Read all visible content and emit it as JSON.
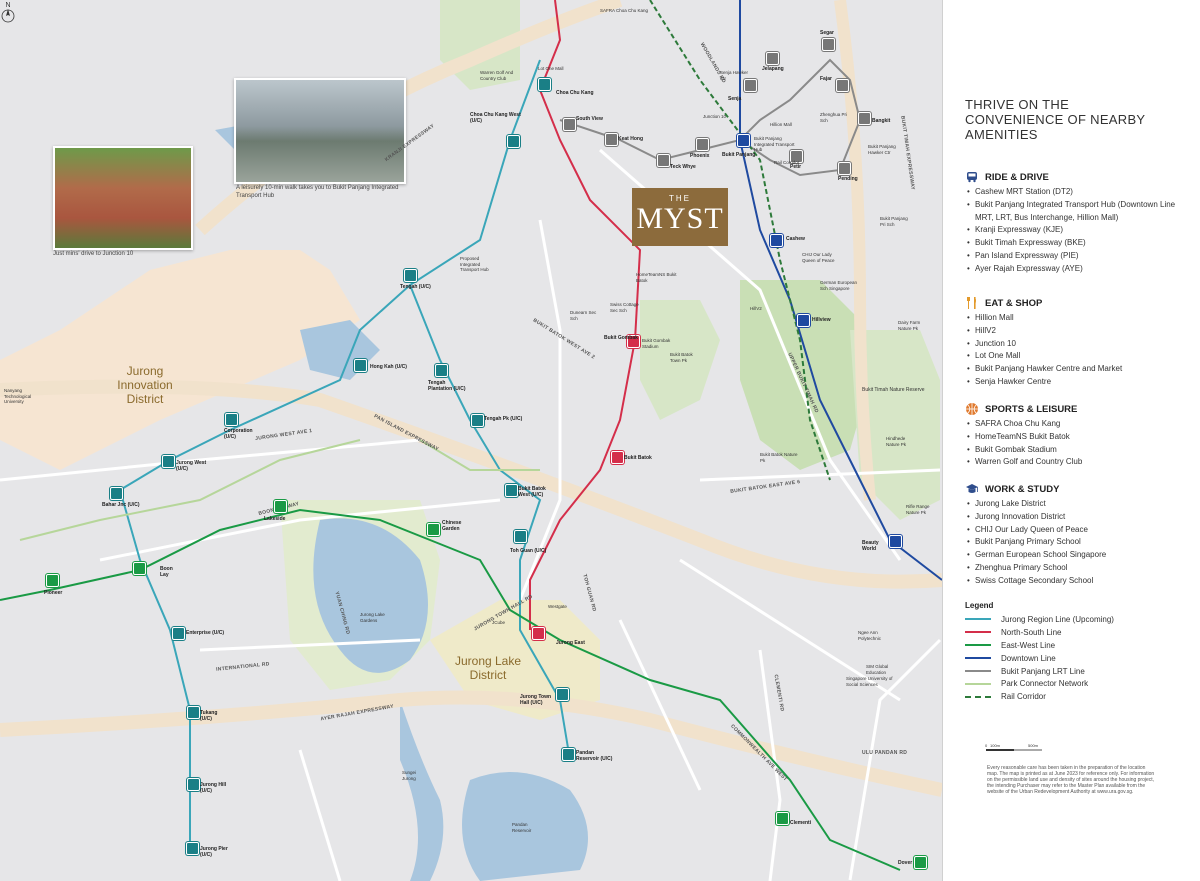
{
  "panel": {
    "title": "THRIVE ON THE CONVENIENCE OF NEARBY AMENITIES",
    "sections": [
      {
        "heading": "RIDE & DRIVE",
        "icon": "car-icon",
        "items": [
          "Cashew MRT Station (DT2)",
          "Bukit Panjang Integrated Transport Hub (Downtown Line MRT, LRT, Bus Interchange, Hillion Mall)",
          "Kranji Expressway (KJE)",
          "Bukit Timah Expressway (BKE)",
          "Pan Island Expressway (PIE)",
          "Ayer Rajah Expressway (AYE)"
        ]
      },
      {
        "heading": "EAT & SHOP",
        "icon": "fork-knife-icon",
        "items": [
          "Hillion Mall",
          "HillV2",
          "Junction 10",
          "Lot One Mall",
          "Bukit Panjang Hawker Centre and Market",
          "Senja Hawker Centre"
        ]
      },
      {
        "heading": "SPORTS & LEISURE",
        "icon": "basketball-icon",
        "items": [
          "SAFRA Choa Chu Kang",
          "HomeTeamNS Bukit Batok",
          "Bukit Gombak Stadium",
          "Warren Golf and Country Club"
        ]
      },
      {
        "heading": "WORK & STUDY",
        "icon": "graduation-cap-icon",
        "items": [
          "Jurong Lake District",
          "Jurong Innovation District",
          "CHIJ Our Lady Queen of Peace",
          "Bukit Panjang Primary School",
          "German European School Singapore",
          "Zhenghua Primary School",
          "Swiss Cottage Secondary School"
        ]
      }
    ],
    "legend": {
      "title": "Legend",
      "items": [
        {
          "label": "Jurong Region Line (Upcoming)",
          "color": "#3aa6b9",
          "style": "solid"
        },
        {
          "label": "North-South Line",
          "color": "#d42e4a",
          "style": "solid"
        },
        {
          "label": "East-West Line",
          "color": "#1a9a45",
          "style": "solid"
        },
        {
          "label": "Downtown Line",
          "color": "#1f4aa0",
          "style": "solid"
        },
        {
          "label": "Bukit Panjang LRT Line",
          "color": "#8a8a8a",
          "style": "solid"
        },
        {
          "label": "Park Connector Network",
          "color": "#b6d69a",
          "style": "solid"
        },
        {
          "label": "Rail Corridor",
          "color": "#2d7a3a",
          "style": "dashed"
        }
      ]
    },
    "scale": {
      "labels": [
        "0",
        "100m",
        "500m"
      ]
    },
    "disclaimer": "Every reasonable care has been taken in the preparation of the location map. The map is printed as at June 2023 for reference only. For information on the permissible land use and density of sites around the housing project, the intending Purchaser may refer to the Master Plan available from the website of the Urban Redevelopment Authority at www.ura.gov.sg."
  },
  "map": {
    "logo": {
      "the": "THE",
      "name": "MYST"
    },
    "photo_caption_1": "A leisurely 10-min walk takes you to Bukit Panjang Integrated Transport Hub",
    "photo_caption_2": "Just mins' drive to Junction 10",
    "districts": {
      "innovation": "Jurong Innovation District",
      "lake": "Jurong Lake District"
    },
    "roads": {
      "kje": "KRANJI EXPRESSWAY",
      "pie": "PAN ISLAND EXPRESSWAY",
      "aye": "AYER RAJAH EXPRESSWAY",
      "bke": "BUKIT TIMAH EXPRESSWAY",
      "uppbt": "UPPER BUKIT TIMAH RD",
      "jurongwest1": "JURONG WEST AVE 1",
      "boonlay": "BOON LAY WAY",
      "intl": "INTERNATIONAL RD",
      "bbwest2": "BUKIT BATOK WEST AVE 2",
      "bbeast6": "BUKIT BATOK EAST AVE 6",
      "clementi": "CLEMENTI RD",
      "ulupandan": "ULU PANDAN RD",
      "woodlands": "WOODLANDS RD",
      "commonwealth": "COMMONWEALTH AVE WEST",
      "tohguan": "TOH GUAN RD",
      "yuanching": "YUAN CHING RD",
      "jurongtown": "JURONG TOWN HALL RD"
    },
    "stations": [
      {
        "code": "MRT",
        "name": "Choa Chu Kang"
      },
      {
        "code": "MRT",
        "name": "Choa Chu Kang West (U/C)"
      },
      {
        "code": "LRT",
        "name": "South View"
      },
      {
        "code": "LRT",
        "name": "Keat Hong"
      },
      {
        "code": "LRT",
        "name": "Teck Whye"
      },
      {
        "code": "LRT",
        "name": "Phoenix"
      },
      {
        "code": "MRT",
        "name": "Bukit Panjang"
      },
      {
        "code": "LRT",
        "name": "Senja"
      },
      {
        "code": "LRT",
        "name": "Jelapang"
      },
      {
        "code": "LRT",
        "name": "Segar"
      },
      {
        "code": "LRT",
        "name": "Fajar"
      },
      {
        "code": "LRT",
        "name": "Bangkit"
      },
      {
        "code": "LRT",
        "name": "Petir"
      },
      {
        "code": "LRT",
        "name": "Pending"
      },
      {
        "code": "MRT",
        "name": "Cashew"
      },
      {
        "code": "MRT",
        "name": "Hillview"
      },
      {
        "code": "MRT",
        "name": "Bukit Gombak"
      },
      {
        "code": "MRT",
        "name": "Bukit Batok"
      },
      {
        "code": "MRT",
        "name": "Tengah (U/C)"
      },
      {
        "code": "MRT",
        "name": "Hong Kah (U/C)"
      },
      {
        "code": "MRT",
        "name": "Tengah Plantation (U/C)"
      },
      {
        "code": "MRT",
        "name": "Tengah Pk (U/C)"
      },
      {
        "code": "MRT",
        "name": "Bukit Batok West (U/C)"
      },
      {
        "code": "MRT",
        "name": "Corporation (U/C)"
      },
      {
        "code": "MRT",
        "name": "Jurong West (U/C)"
      },
      {
        "code": "MRT",
        "name": "Bahar Jnc (U/C)"
      },
      {
        "code": "MRT",
        "name": "Lakeside"
      },
      {
        "code": "MRT",
        "name": "Chinese Garden"
      },
      {
        "code": "MRT",
        "name": "Boon Lay"
      },
      {
        "code": "MRT",
        "name": "Pioneer"
      },
      {
        "code": "MRT",
        "name": "Enterprise (U/C)"
      },
      {
        "code": "MRT",
        "name": "Tukang (U/C)"
      },
      {
        "code": "MRT",
        "name": "Jurong Hill (U/C)"
      },
      {
        "code": "MRT",
        "name": "Jurong Pier (U/C)"
      },
      {
        "code": "MRT",
        "name": "Toh Guan (U/C)"
      },
      {
        "code": "MRT",
        "name": "Jurong East"
      },
      {
        "code": "MRT",
        "name": "Jurong Town Hall (U/C)"
      },
      {
        "code": "MRT",
        "name": "Pandan Reservoir (U/C)"
      },
      {
        "code": "MRT",
        "name": "Beauty World"
      },
      {
        "code": "MRT",
        "name": "Clementi"
      },
      {
        "code": "MRT",
        "name": "Dover"
      }
    ],
    "places": {
      "lotone": "Lot One Mall",
      "junction10": "Junction 10",
      "hillion": "Hillion Mall",
      "hillv2": "HillV2",
      "safra": "SAFRA Choa Chu Kang",
      "warren": "Warren Golf And Country Club",
      "hometeam": "HomeTeamNS Bukit Batok",
      "swiss": "Swiss Cottage Sec Sch",
      "gombakstadium": "Bukit Gombak Stadium",
      "bbtownpk": "Bukit Batok Town Pk",
      "bbnaturepk": "Bukit Batok Nature Pk",
      "btnr": "Bukit Timah Nature Reserve",
      "hindhede": "Hindhede Nature Pk",
      "dairy": "Dairy Farm Nature Pk",
      "rifle": "Rifle Range Nature Pk",
      "chij": "CHIJ Our Lady Queen of Peace",
      "german": "German European Sch Singapore",
      "bpps": "Bukit Panjang Pri Sch",
      "zhenghua": "Zhenghua Pri Sch",
      "bphawker": "Bukit Panjang Hawker Ctr",
      "senjahawker": "Senja Hawker Ctr",
      "jurongbird": "Jurong Lake Gardens",
      "pandan": "Pandan Reservoir",
      "jcube": "JCube",
      "westgate": "Westgate",
      "ntu": "Nanyang Technological University",
      "ngeeann": "Ngee Ann Polytechnic",
      "sim": "SIM Global Education",
      "suss": "Singapore University of Social Sciences",
      "tengahhub": "Proposed Integrated Transport Hub",
      "dunearn": "Dunearn Sec Sch",
      "bpith": "Bukit Panjang Integrated Transport Hub",
      "sungeijurong": "Sungei Jurong",
      "railcorridor": "Rail Corridor"
    }
  }
}
